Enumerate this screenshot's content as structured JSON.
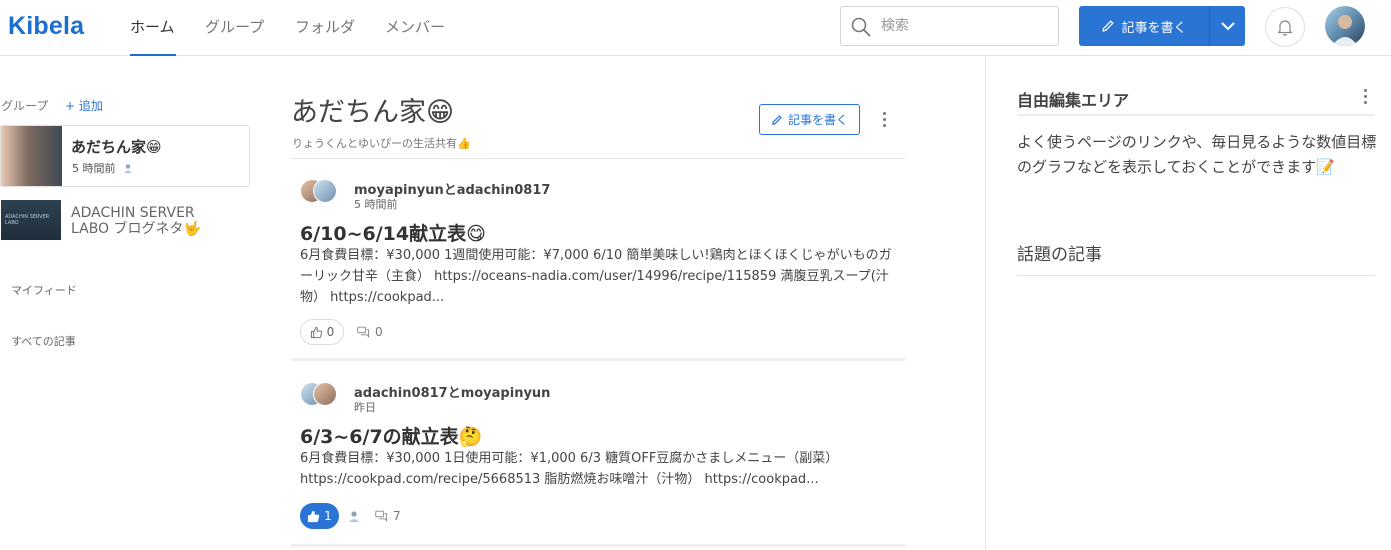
{
  "header": {
    "logo": "Kibela",
    "nav": [
      {
        "label": "ホーム",
        "active": true
      },
      {
        "label": "グループ",
        "active": false
      },
      {
        "label": "フォルダ",
        "active": false
      },
      {
        "label": "メンバー",
        "active": false
      }
    ],
    "search_placeholder": "検索",
    "write_button": "記事を書く",
    "accent_color": "#2a75d3"
  },
  "sidebar": {
    "groups_label": "グループ",
    "add_label": "+ 追加",
    "groups": [
      {
        "name": "あだちん家😁",
        "time": "5 時間前",
        "selected": true
      },
      {
        "name": "ADACHIN SERVER LABO ブログネタ🤟",
        "time": "",
        "selected": false,
        "thumb_text": "ADACHIN SERVER LABO"
      }
    ],
    "links": [
      "マイフィード",
      "すべての記事"
    ]
  },
  "main": {
    "title": "あだちん家😁",
    "subtitle": "りょうくんとゆいぴーの生活共有👍",
    "write_button": "記事を書く",
    "posts": [
      {
        "authors": "moyapinyunとadachin0817",
        "time": "5 時間前",
        "title": "6/10~6/14献立表😋",
        "body": "6月食費目標：¥30,000 1週間使用可能：¥7,000 6/10 簡単美味しい!鶏肉とほくほくじゃがいものガーリック甘辛（主食） https://oceans-nadia.com/user/14996/recipe/115859 満腹豆乳スープ(汁物） https://cookpad...",
        "likes": "0",
        "liked": false,
        "comments": "0"
      },
      {
        "authors": "adachin0817とmoyapinyun",
        "time": "昨日",
        "title": "6/3~6/7の献立表🤔",
        "body": "6月食費目標：¥30,000 1日使用可能：¥1,000 6/3 糖質OFF豆腐かさましメニュー（副菜） https://cookpad.com/recipe/5668513 脂肪燃焼お味噌汁（汁物） https://cookpad...",
        "likes": "1",
        "liked": true,
        "comments": "7"
      }
    ]
  },
  "right_panel": {
    "title": "自由編集エリア",
    "text": "よく使うページのリンクや、毎日見るような数値目標のグラフなどを表示しておくことができます📝",
    "heading": "話題の記事"
  }
}
